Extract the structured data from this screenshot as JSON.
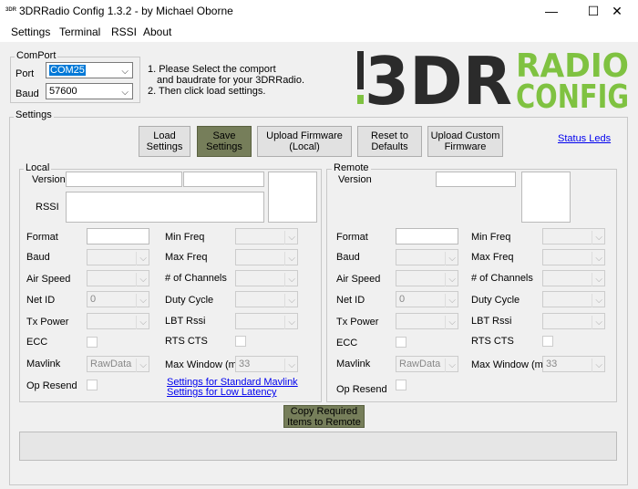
{
  "window": {
    "app_icon_text": "3DR",
    "title": "3DRRadio Config 1.3.2 - by Michael Oborne",
    "minimize": "—",
    "maximize": "☐",
    "close": "✕"
  },
  "menu": [
    "Settings",
    "Terminal",
    "RSSI",
    "About"
  ],
  "comport": {
    "group_title": "ComPort",
    "port_label": "Port",
    "port_value": "COM25",
    "baud_label": "Baud",
    "baud_value": "57600",
    "instruction_1": "1. Please Select the comport",
    "instruction_1b": "and baudrate for your 3DRRadio.",
    "instruction_2": "2. Then click load settings."
  },
  "logo": {
    "main": "3DR",
    "line1": "RADIO",
    "line2": "CONFIG",
    "colors": {
      "dark": "#2b2b2b",
      "green": "#7fc241"
    }
  },
  "settings": {
    "group_title": "Settings",
    "buttons": {
      "load": [
        "Load",
        "Settings"
      ],
      "save": [
        "Save",
        "Settings"
      ],
      "upload_fw": [
        "Upload Firmware",
        "(Local)"
      ],
      "reset": [
        "Reset to",
        "Defaults"
      ],
      "upload_custom": [
        "Upload Custom",
        "Firmware"
      ]
    },
    "status_leds": "Status Leds"
  },
  "local": {
    "group_title": "Local",
    "version_label": "Version",
    "rssi_label": "RSSI",
    "format_label": "Format",
    "baud_label": "Baud",
    "air_speed_label": "Air Speed",
    "net_id_label": "Net ID",
    "net_id_value": "0",
    "tx_power_label": "Tx Power",
    "ecc_label": "ECC",
    "mavlink_label": "Mavlink",
    "mavlink_value": "RawData",
    "op_resend_label": "Op Resend",
    "min_freq_label": "Min Freq",
    "max_freq_label": "Max Freq",
    "channels_label": "# of Channels",
    "duty_cycle_label": "Duty Cycle",
    "lbt_rssi_label": "LBT Rssi",
    "rts_cts_label": "RTS CTS",
    "max_window_label": "Max Window (ms)",
    "max_window_value": "33",
    "link_standard": "Settings for Standard Mavlink",
    "link_low_latency": "Settings for Low Latency"
  },
  "remote": {
    "group_title": "Remote",
    "version_label": "Version",
    "format_label": "Format",
    "baud_label": "Baud",
    "air_speed_label": "Air Speed",
    "net_id_label": "Net ID",
    "net_id_value": "0",
    "tx_power_label": "Tx Power",
    "ecc_label": "ECC",
    "mavlink_label": "Mavlink",
    "mavlink_value": "RawData",
    "op_resend_label": "Op Resend",
    "min_freq_label": "Min Freq",
    "max_freq_label": "Max Freq",
    "channels_label": "# of Channels",
    "duty_cycle_label": "Duty Cycle",
    "lbt_rssi_label": "LBT Rssi",
    "rts_cts_label": "RTS CTS",
    "max_window_label": "Max Window (ms)",
    "max_window_value": "33"
  },
  "copy_button": [
    "Copy Required",
    "Items to Remote"
  ],
  "status_bar_text": ""
}
